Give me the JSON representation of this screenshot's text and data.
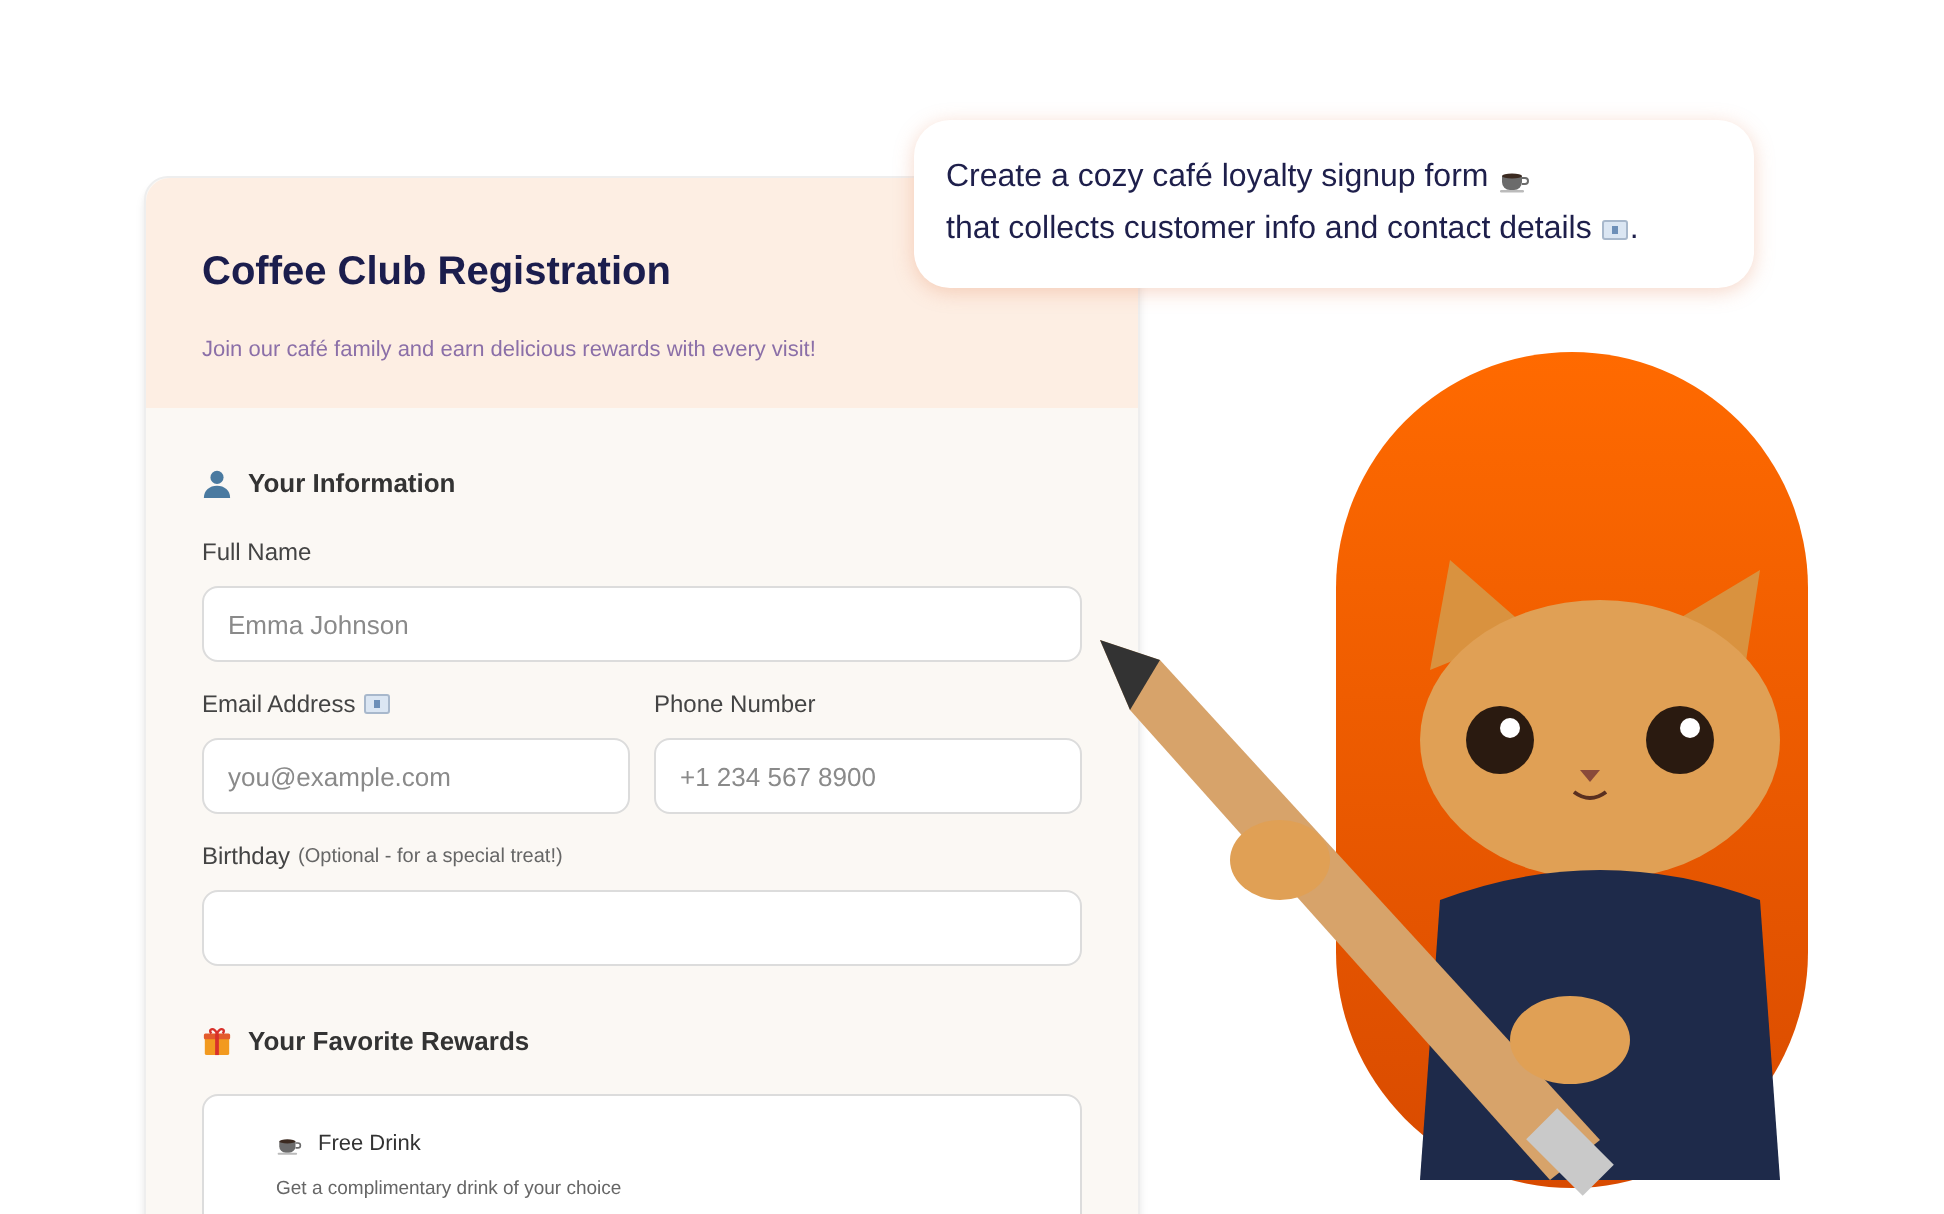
{
  "form": {
    "title": "Coffee Club Registration",
    "subtitle": "Join our café family and earn delicious rewards with every visit!",
    "sections": [
      {
        "kind": "info",
        "heading": "Your Information",
        "fields": [
          {
            "kind": "text",
            "label": "Full Name",
            "placeholder": "Emma Johnson"
          },
          {
            "kind": "email",
            "label": "Email Address",
            "placeholder": "you@example.com"
          },
          {
            "kind": "phone",
            "label": "Phone Number",
            "placeholder": "+1 234 567 8900"
          },
          {
            "kind": "date",
            "label": "Birthday",
            "note": "(Optional - for a special treat!)"
          }
        ]
      },
      {
        "kind": "rewards",
        "heading": "Your Favorite Rewards",
        "rewards": [
          {
            "title": "Free Drink",
            "description": "Get a complimentary drink of your choice"
          }
        ]
      }
    ]
  },
  "prompt": {
    "text_1": "Create a cozy café loyalty signup form",
    "text_2": "that collects customer info and contact details",
    "text_3": "."
  }
}
